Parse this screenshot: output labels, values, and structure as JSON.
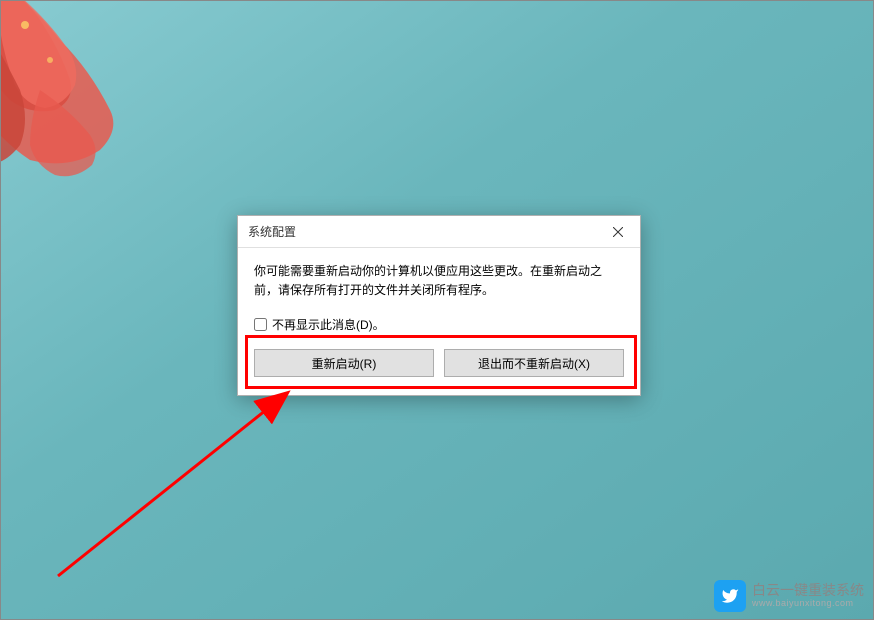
{
  "dialog": {
    "title": "系统配置",
    "message": "你可能需要重新启动你的计算机以便应用这些更改。在重新启动之前，请保存所有打开的文件并关闭所有程序。",
    "checkbox_label": "不再显示此消息(D)。",
    "restart_button": "重新启动(R)",
    "exit_button": "退出而不重新启动(X)"
  },
  "watermark": {
    "main_text": "白云一键重装系统",
    "sub_text": "www.baiyunxitong.com"
  },
  "annotation": {
    "highlight_color": "#ff0000"
  }
}
